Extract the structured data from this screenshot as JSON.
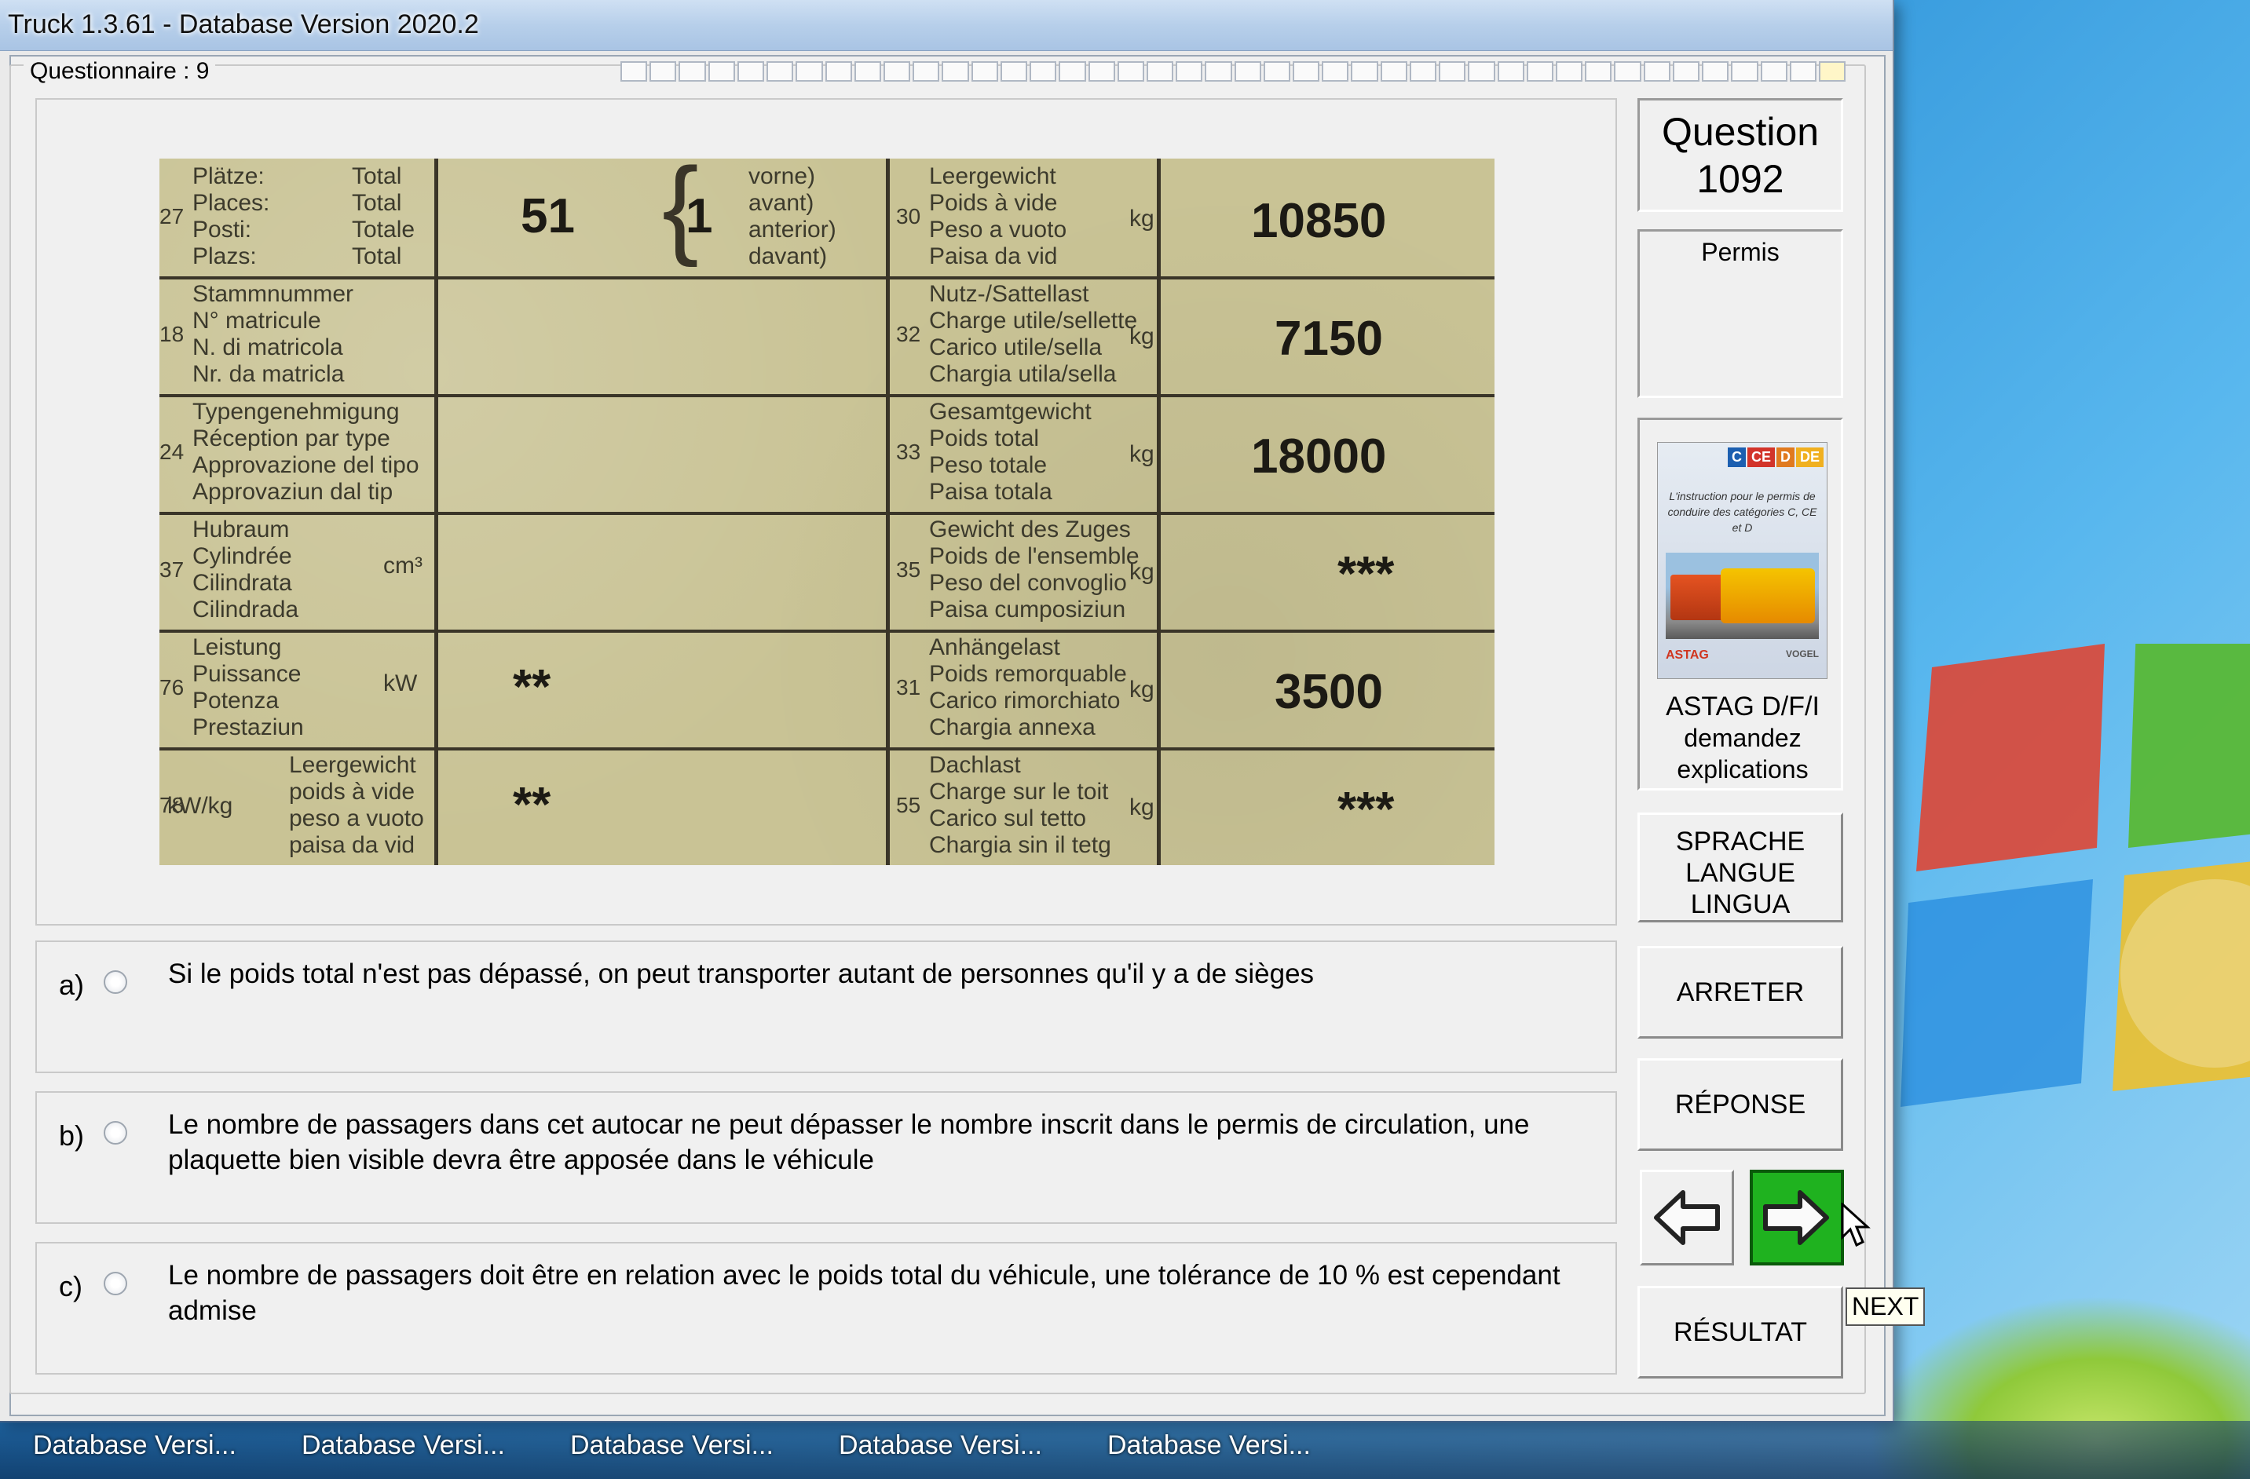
{
  "window": {
    "title": "Truck 1.3.61 - Database Version 2020.2"
  },
  "questionnaire": {
    "label": "Questionnaire : 9",
    "progress_total": 42,
    "progress_done": 0
  },
  "document": {
    "rows": [
      {
        "code_left": "27",
        "labels_left": [
          "Plätze:",
          "Places:",
          "Posti:",
          "Plazs:"
        ],
        "totals": [
          "Total",
          "Total",
          "Totale",
          "Total"
        ],
        "value_a": "51",
        "value_b": "1",
        "braced": [
          "vorne)",
          "avant)",
          "anterior)",
          "davant)"
        ],
        "code_right": "30",
        "labels_right": [
          "Leergewicht",
          "Poids à vide",
          "Peso a vuoto",
          "Paisa da vid"
        ],
        "unit": "kg",
        "value_right": "10850"
      },
      {
        "code_left": "18",
        "labels_left": [
          "Stammnummer",
          "N° matricule",
          "N. di matricola",
          "Nr. da matricla"
        ],
        "code_right": "32",
        "labels_right": [
          "Nutz-/Sattellast",
          "Charge utile/sellette",
          "Carico utile/sella",
          "Chargia utila/sella"
        ],
        "unit": "kg",
        "value_right": "7150"
      },
      {
        "code_left": "24",
        "labels_left": [
          "Typengenehmigung",
          "Réception par type",
          "Approvazione del tipo",
          "Approvaziun dal tip"
        ],
        "code_right": "33",
        "labels_right": [
          "Gesamtgewicht",
          "Poids total",
          "Peso totale",
          "Paisa totala"
        ],
        "unit": "kg",
        "value_right": "18000"
      },
      {
        "code_left": "37",
        "labels_left": [
          "Hubraum",
          "Cylindrée",
          "Cilindrata",
          "Cilindrada"
        ],
        "unit_left": "cm³",
        "code_right": "35",
        "labels_right": [
          "Gewicht des Zuges",
          "Poids de l'ensemble",
          "Peso del convoglio",
          "Paisa cumposiziun"
        ],
        "unit": "kg",
        "value_right": "***"
      },
      {
        "code_left": "76",
        "labels_left": [
          "Leistung",
          "Puissance",
          "Potenza",
          "Prestaziun"
        ],
        "unit_left": "kW",
        "value_a": "**",
        "code_right": "31",
        "labels_right": [
          "Anhängelast",
          "Poids remorquable",
          "Carico rimorchiato",
          "Chargia annexa"
        ],
        "unit": "kg",
        "value_right": "3500"
      },
      {
        "code_left": "78",
        "label_kw": "kW/kg",
        "labels_left": [
          "Leergewicht",
          "poids à vide",
          "peso a vuoto",
          "paisa da vid"
        ],
        "value_a": "**",
        "code_right": "55",
        "labels_right": [
          "Dachlast",
          "Charge sur le toit",
          "Carico sul tetto",
          "Chargia sin il tetg"
        ],
        "unit": "kg",
        "value_right": "***"
      }
    ]
  },
  "answers": [
    {
      "letter": "a)",
      "text": "Si le poids total n'est pas dépassé, on peut transporter autant de personnes qu'il y a de sièges"
    },
    {
      "letter": "b)",
      "text": "Le nombre de passagers dans cet autocar ne peut dépasser le nombre inscrit dans le permis de circulation, une plaquette bien visible devra être apposée dans le véhicule"
    },
    {
      "letter": "c)",
      "text": "Le nombre de passagers doit être en relation avec le poids total du véhicule, une tolérance de 10 % est cependant admise"
    }
  ],
  "sidebar": {
    "question_label": "Question",
    "question_number": "1092",
    "permis_label": "Permis",
    "book": {
      "tags": [
        "C",
        "CE",
        "D",
        "DE"
      ],
      "cover_text": "L'instruction pour le permis de conduire des catégories C, CE et D",
      "logo_left": "ASTAG",
      "logo_right": "VOGEL",
      "caption_line1": "ASTAG D/F/I",
      "caption_line2": "demandez",
      "caption_line3": "explications"
    },
    "sprache": [
      "SPRACHE",
      "LANGUE",
      "LINGUA"
    ],
    "arreter": "ARRETER",
    "reponse": "RÉPONSE",
    "resultat": "RÉSULTAT",
    "prev_icon": "arrow-left-icon",
    "next_icon": "arrow-right-icon",
    "tooltip": "NEXT"
  },
  "taskbar": {
    "items": [
      "Database Versi...",
      "Database Versi...",
      "Database Versi...",
      "Database Versi...",
      "Database Versi..."
    ]
  },
  "colors": {
    "next_button": "#1fb21f",
    "document_bg": "#c9c395"
  }
}
